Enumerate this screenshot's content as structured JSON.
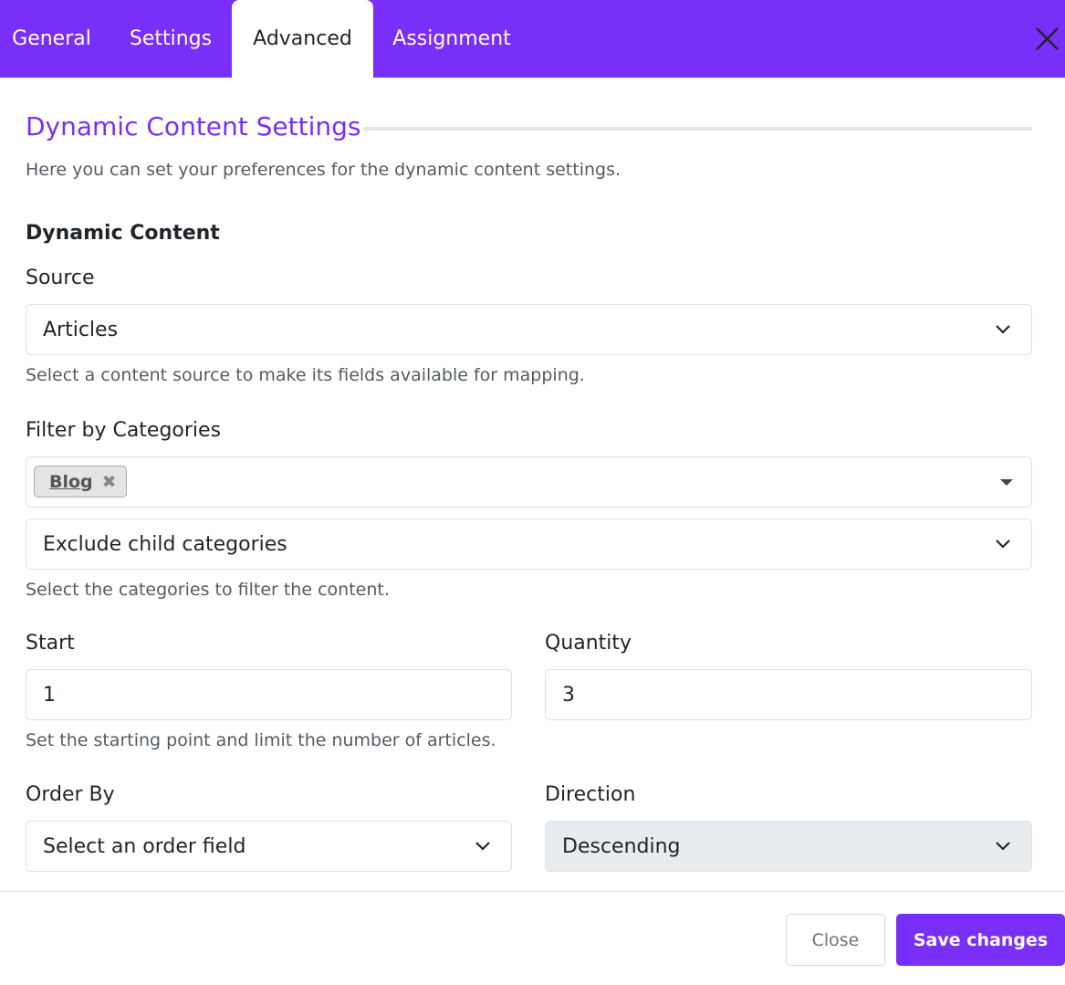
{
  "tabs": {
    "general": "General",
    "settings": "Settings",
    "advanced": "Advanced",
    "assignment": "Assignment",
    "active": "Advanced"
  },
  "section": {
    "title": "Dynamic Content Settings",
    "description": "Here you can set your preferences for the dynamic content settings."
  },
  "dynamic_content": {
    "heading": "Dynamic Content",
    "source": {
      "label": "Source",
      "value": "Articles",
      "help": "Select a content source to make its fields available for mapping."
    },
    "filter": {
      "label": "Filter by Categories",
      "selected_tags": [
        "Blog"
      ],
      "remove_glyph": "✖",
      "child_option": "Exclude child categories",
      "help": "Select the categories to filter the content."
    },
    "start": {
      "label": "Start",
      "value": "1"
    },
    "quantity": {
      "label": "Quantity",
      "value": "3"
    },
    "range_help": "Set the starting point and limit the number of articles.",
    "order_by": {
      "label": "Order By",
      "value": "Select an order field"
    },
    "direction": {
      "label": "Direction",
      "value": "Descending",
      "disabled": true
    }
  },
  "footer": {
    "close_label": "Close",
    "save_label": "Save changes"
  },
  "colors": {
    "accent": "#7a2ff9",
    "rule": "#e3e4ea",
    "muted_text": "#555b61",
    "disabled_bg": "#e9ecef"
  },
  "icons": {
    "close": "close-icon",
    "select_arrow": "chevron-down-icon",
    "multiselect_arrow": "caret-down-icon",
    "tag_remove": "remove-tag-icon"
  }
}
